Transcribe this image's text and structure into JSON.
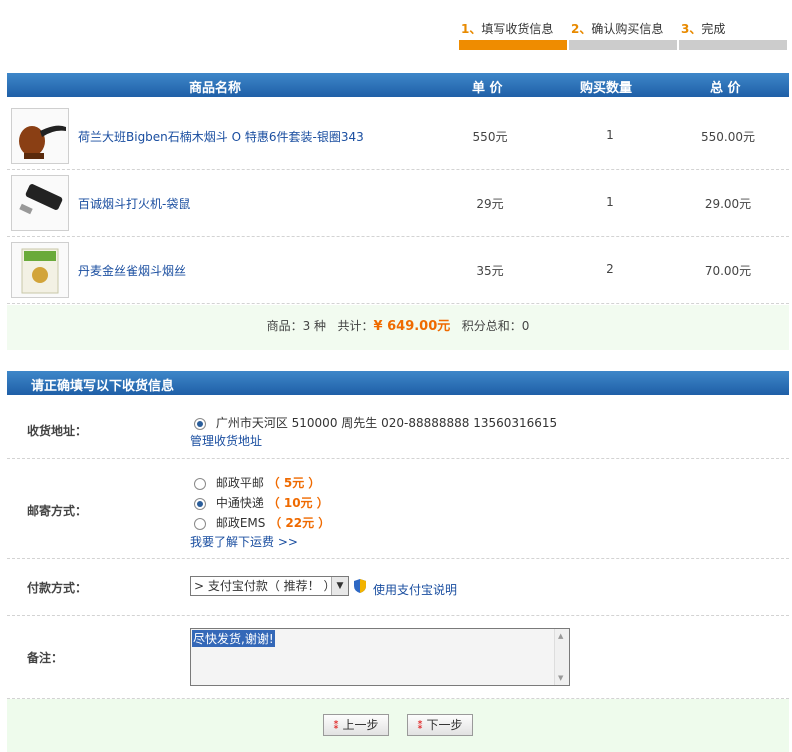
{
  "steps": [
    {
      "num": "1、",
      "label": "填写收货信息",
      "active": true
    },
    {
      "num": "2、",
      "label": "确认购买信息",
      "active": false
    },
    {
      "num": "3、",
      "label": "完成",
      "active": false
    }
  ],
  "cart": {
    "headers": {
      "name": "商品名称",
      "price": "单 价",
      "qty": "购买数量",
      "total": "总 价"
    },
    "items": [
      {
        "name": "荷兰大班Bigben石楠木烟斗 O 特惠6件套装-银圈343",
        "price": "550元",
        "qty": "1",
        "total": "550.00元",
        "icon": "pipe-thumbnail"
      },
      {
        "name": "百诚烟斗打火机-袋鼠",
        "price": "29元",
        "qty": "1",
        "total": "29.00元",
        "icon": "lighter-thumbnail"
      },
      {
        "name": "丹麦金丝雀烟斗烟丝",
        "price": "35元",
        "qty": "2",
        "total": "70.00元",
        "icon": "tobacco-thumbnail"
      }
    ],
    "summary": {
      "kinds_label": "商品：3 种",
      "total_prefix": "共计：",
      "total_value": "¥ 649.00元",
      "points": "积分总和：0"
    }
  },
  "shipping_form": {
    "title": "请正确填写以下收货信息",
    "address": {
      "label": "收货地址：",
      "value": "广州市天河区  510000  周先生  020-88888888  13560316615",
      "manage_link": "管理收货地址"
    },
    "delivery": {
      "label": "邮寄方式：",
      "options": [
        {
          "name": "邮政平邮",
          "price": "（ 5元 ）",
          "selected": false
        },
        {
          "name": "中通快递",
          "price": "（ 10元 ）",
          "selected": true
        },
        {
          "name": "邮政EMS",
          "price": "（ 22元 ）",
          "selected": false
        }
      ],
      "info_link": "我要了解下运费  >>"
    },
    "payment": {
      "label": "付款方式：",
      "selected": "> 支付宝付款（ 推荐！ ）",
      "help_link": "使用支付宝说明"
    },
    "remark": {
      "label": "备注：",
      "value": "尽快发货,谢谢!"
    }
  },
  "buttons": {
    "prev": "上一步",
    "next": "下一步"
  },
  "colors": {
    "accent": "#ef8c00",
    "header_blue": "#2a6fb8",
    "link": "#1a4ea0",
    "price": "#ef6a00"
  }
}
